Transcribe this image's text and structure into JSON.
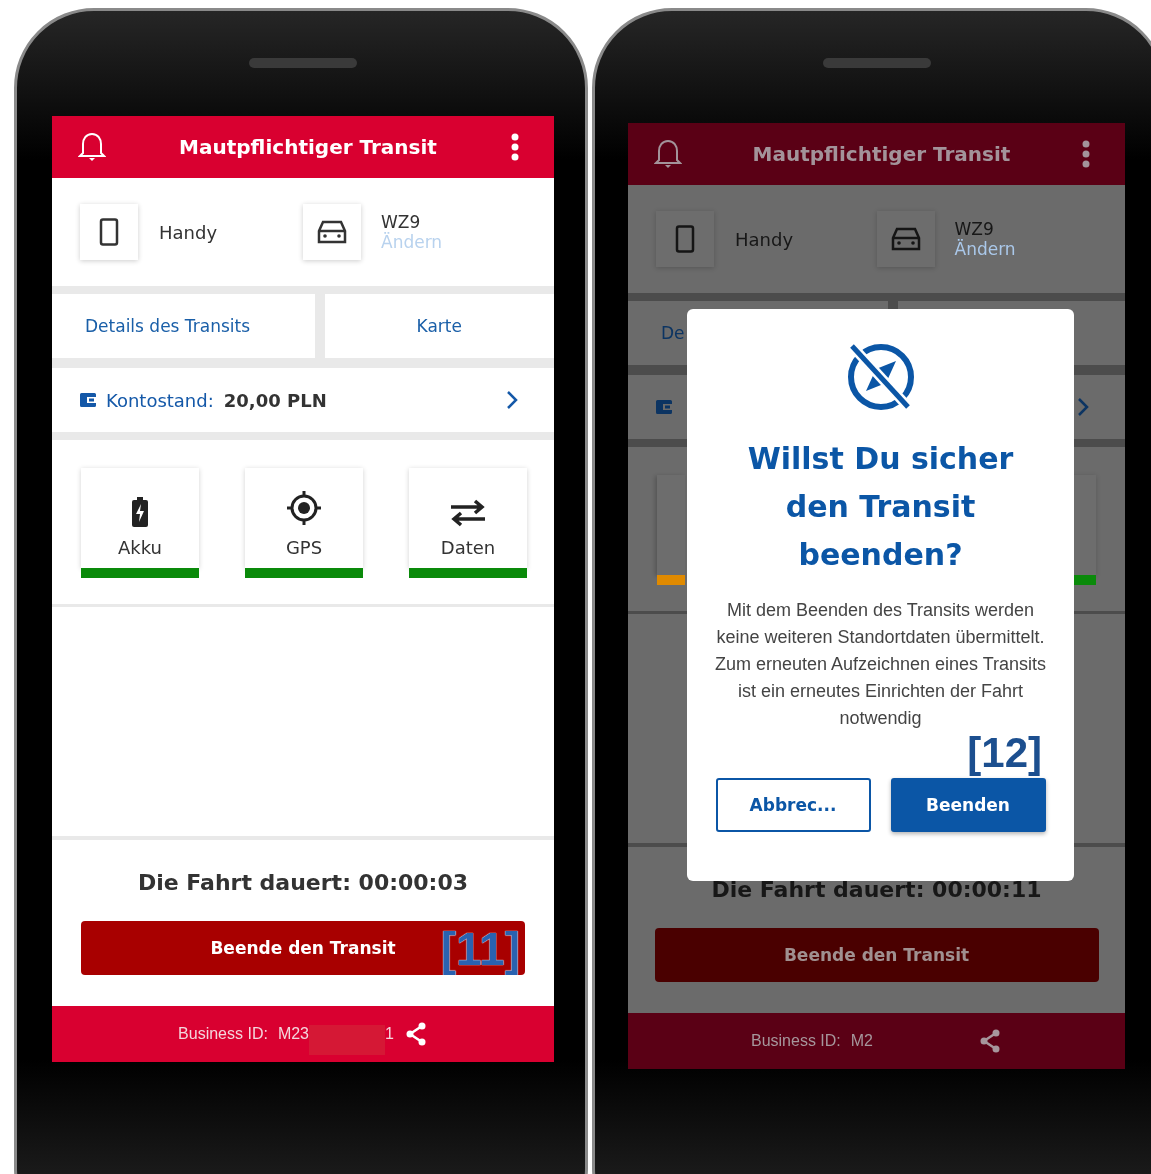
{
  "phones": [
    {
      "dimmed": false,
      "header": {
        "title": "Mautpflichtiger Transit"
      },
      "device": {
        "label": "Handy"
      },
      "vehicle": {
        "plate": "WZ9",
        "change_link": "Ändern"
      },
      "tabs": [
        {
          "label": "Details des Transits"
        },
        {
          "label": "Karte"
        }
      ],
      "balance": {
        "label": "Kontostand:",
        "value": "20,00 PLN"
      },
      "status_cards": [
        {
          "kind": "battery",
          "label": "Akku",
          "color": "#0a8a0a"
        },
        {
          "kind": "gps",
          "label": "GPS",
          "color": "#0a8a0a"
        },
        {
          "kind": "data",
          "label": "Daten",
          "color": "#0a8a0a"
        }
      ],
      "duration": "Die Fahrt dauert: 00:00:03",
      "end_button": "Beende den Transit",
      "callout": "[11]",
      "footer": {
        "label": "Business ID:",
        "id_start": "M23",
        "redacted": true,
        "id_end": "1"
      }
    },
    {
      "dimmed": true,
      "header": {
        "title": "Mautpflichtiger Transit"
      },
      "device": {
        "label": "Handy"
      },
      "vehicle": {
        "plate": "WZ9",
        "change_link": "Ändern"
      },
      "tabs": [
        {
          "label": "De"
        }
      ],
      "status_cards": [
        {
          "color": "#e08a00"
        },
        {
          "color": "#0a8a0a"
        }
      ],
      "duration": "Die Fahrt dauert: 00:00:11",
      "end_button": "Beende den Transit",
      "footer": {
        "label": "Business ID:",
        "id_start": "M2",
        "redacted": false
      },
      "dialog": {
        "title": "Willst Du sicher den Transit beenden?",
        "body": "Mit dem Beenden des Transits werden keine weiteren Standortdaten übermittelt. Zum erneuten Aufzeichnen eines Transits ist ein erneutes Einrichten der Fahrt notwendig",
        "buttons": [
          {
            "kind": "secondary",
            "label": "Abbrec..."
          },
          {
            "kind": "primary",
            "label": "Beenden"
          }
        ],
        "callout": "[12]"
      }
    }
  ]
}
